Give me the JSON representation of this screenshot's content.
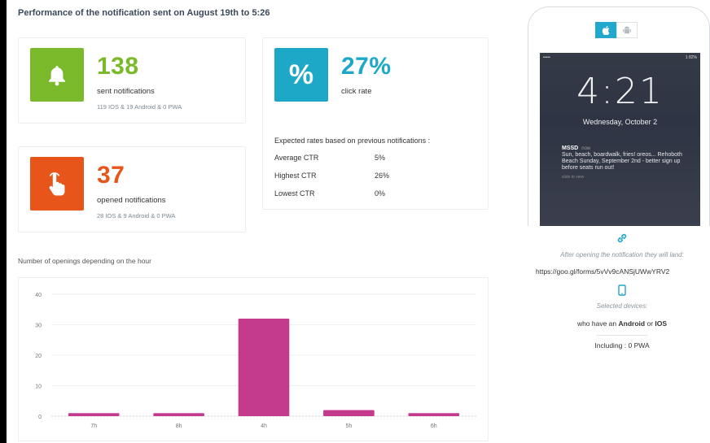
{
  "report": {
    "title": "Performance of the notification sent on August 19th to 5:26"
  },
  "cards": {
    "sent": {
      "value": "138",
      "label": "sent notifications",
      "sub": "119 IOS & 19 Android & 0 PWA",
      "color": "#7ab929",
      "icon": "bell-icon"
    },
    "opened": {
      "value": "37",
      "label": "opened notifications",
      "sub": "28 IOS & 9 Android & 0 PWA",
      "color": "#e8551b",
      "icon": "tap-hand-icon"
    },
    "click": {
      "value": "27%",
      "label": "click rate",
      "color": "#1ea8c7",
      "icon": "percent-icon"
    }
  },
  "rates": {
    "title": "Expected rates based on previous notifications :",
    "rows": [
      {
        "name": "Average CTR",
        "value": "5%"
      },
      {
        "name": "Highest CTR",
        "value": "26%"
      },
      {
        "name": "Lowest CTR",
        "value": "0%"
      }
    ]
  },
  "chart_title": "Number of openings depending on the hour",
  "chart_data": {
    "type": "bar",
    "title": "",
    "xlabel": "",
    "ylabel": "",
    "categories": [
      "7h",
      "8h",
      "4h",
      "5h",
      "6h"
    ],
    "values": [
      1,
      1,
      32,
      2,
      1
    ],
    "ylim": [
      0,
      40
    ],
    "yticks": [
      0,
      10,
      20,
      30,
      40
    ],
    "grid": true,
    "color": "#c43b8e"
  },
  "phone": {
    "os_active": "apple-icon",
    "os_inactive": "android-icon",
    "status_left": "•••••",
    "status_right": "1 82%",
    "time": "4:21",
    "date": "Wednesday, October 2",
    "notif_app": "MSSD",
    "notif_when": "now",
    "notif_body": "Sun, beach, boardwalk, fries! oreos... Rehoboth Beach Sunday, September 2nd - better sign up before seats run out!",
    "notif_meta": "slide to view"
  },
  "landing": {
    "icon": "link-icon",
    "text": "After opening the notification they will land:",
    "url": "https://goo.gl/forms/5vVv9cANSjUWwYRV2"
  },
  "devices": {
    "icon": "phone-icon",
    "label": "Selected devices:",
    "prefix": "who have an",
    "android": "Android",
    "or": "or",
    "ios": "IOS",
    "including": "Including : 0 PWA"
  }
}
